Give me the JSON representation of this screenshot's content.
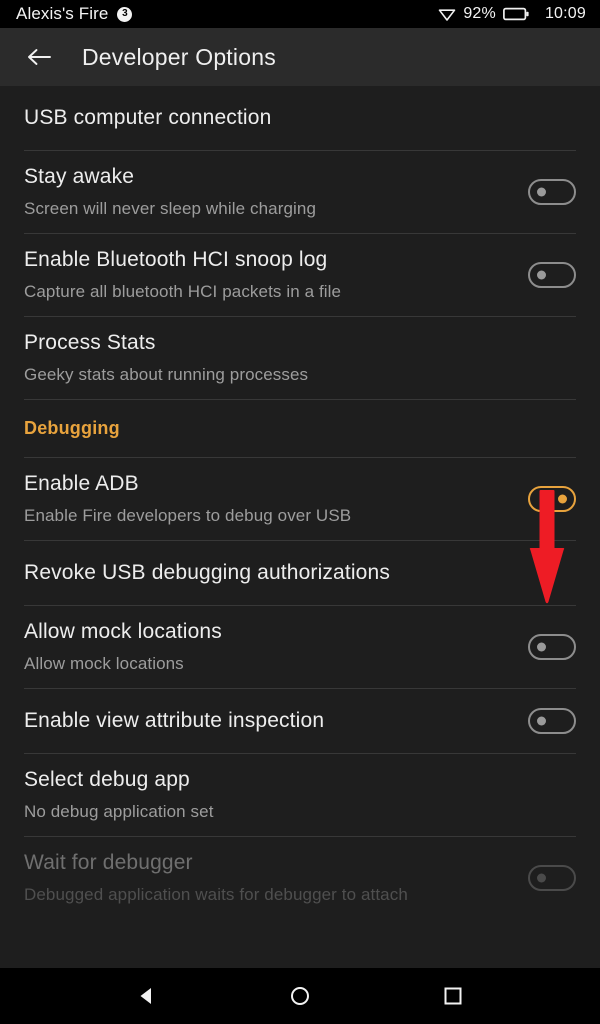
{
  "status_bar": {
    "device_name": "Alexis's Fire",
    "notification_count": "3",
    "wifi_icon": "wifi-icon",
    "battery_percent": "92%",
    "battery_icon": "battery-icon",
    "clock": "10:09"
  },
  "action_bar": {
    "back_icon": "back-arrow-icon",
    "title": "Developer Options"
  },
  "colors": {
    "accent": "#e8a33d",
    "annotation": "#ee1c25",
    "background": "#1e1e1e",
    "action_bar": "#2b2b2b",
    "title_text": "#ededed",
    "sub_text": "#9d9d9d",
    "divider": "#383838"
  },
  "annotation": {
    "shape": "down-arrow",
    "color": "#ee1c25",
    "points_at": "enable-adb-toggle"
  },
  "rows": [
    {
      "id": "usb-computer-connection",
      "title": "USB computer connection",
      "subtitle": null,
      "toggle": null,
      "disabled": false
    },
    {
      "id": "stay-awake",
      "title": "Stay awake",
      "subtitle": "Screen will never sleep while charging",
      "toggle": "off",
      "disabled": false
    },
    {
      "id": "enable-bluetooth-hci-snoop-log",
      "title": "Enable Bluetooth HCI snoop log",
      "subtitle": "Capture all bluetooth HCI packets in a file",
      "toggle": "off",
      "disabled": false
    },
    {
      "id": "process-stats",
      "title": "Process Stats",
      "subtitle": "Geeky stats about running processes",
      "toggle": null,
      "disabled": false
    },
    {
      "id": "debugging-section",
      "title": "Debugging",
      "section": true
    },
    {
      "id": "enable-adb",
      "title": "Enable ADB",
      "subtitle": "Enable Fire developers to debug over USB",
      "toggle": "on",
      "disabled": false
    },
    {
      "id": "revoke-usb-debugging-authorizations",
      "title": "Revoke USB debugging authorizations",
      "subtitle": null,
      "toggle": null,
      "disabled": false
    },
    {
      "id": "allow-mock-locations",
      "title": "Allow mock locations",
      "subtitle": "Allow mock locations",
      "toggle": "off",
      "disabled": false
    },
    {
      "id": "enable-view-attribute-inspection",
      "title": "Enable view attribute inspection",
      "subtitle": null,
      "toggle": "off",
      "disabled": false
    },
    {
      "id": "select-debug-app",
      "title": "Select debug app",
      "subtitle": "No debug application set",
      "toggle": null,
      "disabled": false
    },
    {
      "id": "wait-for-debugger",
      "title": "Wait for debugger",
      "subtitle": "Debugged application waits for debugger to attach",
      "toggle": "off",
      "disabled": true
    }
  ],
  "nav_bar": {
    "back_icon": "nav-back-triangle-icon",
    "home_icon": "nav-home-circle-icon",
    "recents_icon": "nav-recents-square-icon"
  }
}
